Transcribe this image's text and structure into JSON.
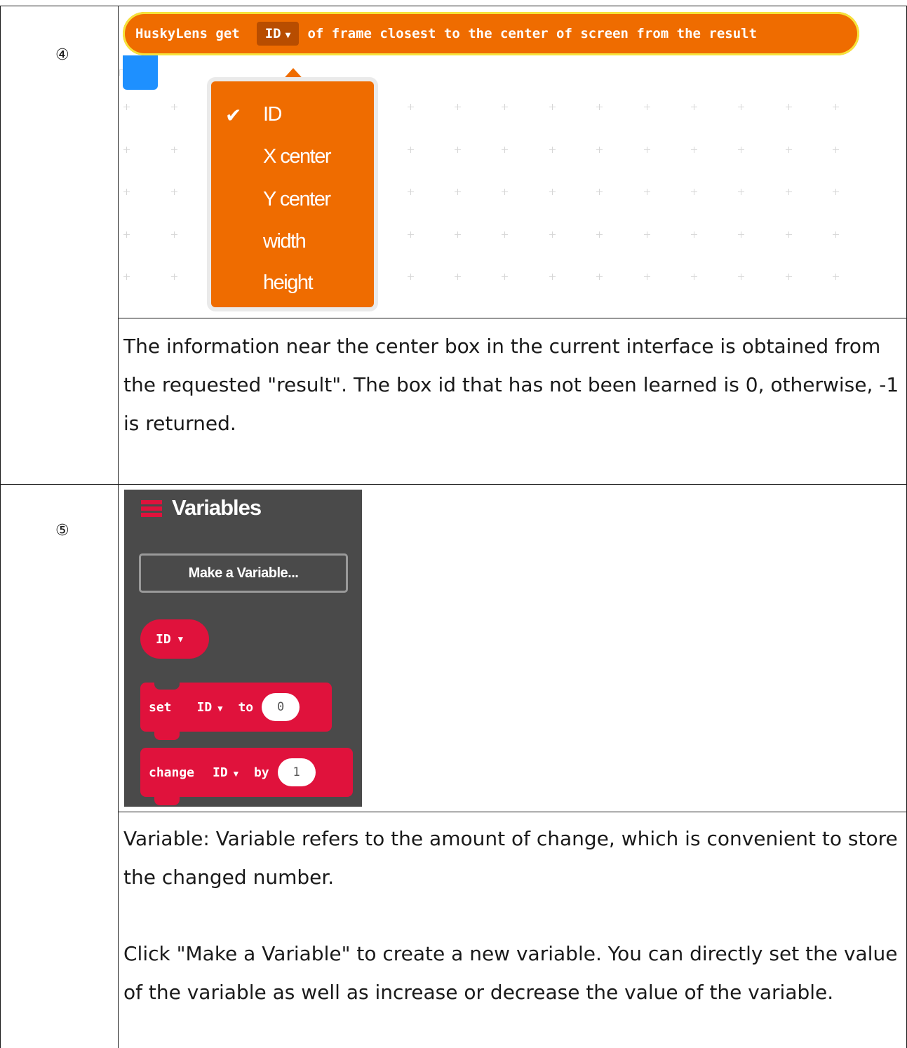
{
  "rows": [
    {
      "number": "④",
      "description": "The information near the center box in the current interface is obtained from the requested \"result\". The box id that has not been learned is 0, otherwise, -1 is returned."
    },
    {
      "number": "⑤",
      "description_1": "Variable: Variable refers to the amount of change, which is convenient to store the changed number.",
      "description_2": "Click \"Make a  Variable\" to create a new variable. You can directly set the value of the variable as well as increase or decrease the value of the variable."
    }
  ],
  "huskylens_block": {
    "prefix": "HuskyLens get",
    "dropdown_value": "ID",
    "suffix": "of frame closest to the center of screen from the result",
    "accent_color": "#ef6c00",
    "highlight_color": "#f6e33b"
  },
  "dropdown_menu": {
    "selected": "ID",
    "items": [
      "ID",
      "X center",
      "Y center",
      "width",
      "height"
    ]
  },
  "variables_panel": {
    "title": "Variables",
    "make_button": "Make a Variable...",
    "variable_block": "ID",
    "set_block": {
      "keyword": "set",
      "variable": "ID",
      "to": "to",
      "value": "0"
    },
    "change_block": {
      "keyword": "change",
      "variable": "ID",
      "by": "by",
      "value": "1"
    },
    "background_color": "#4a4a4a",
    "block_color": "#e0123c"
  }
}
